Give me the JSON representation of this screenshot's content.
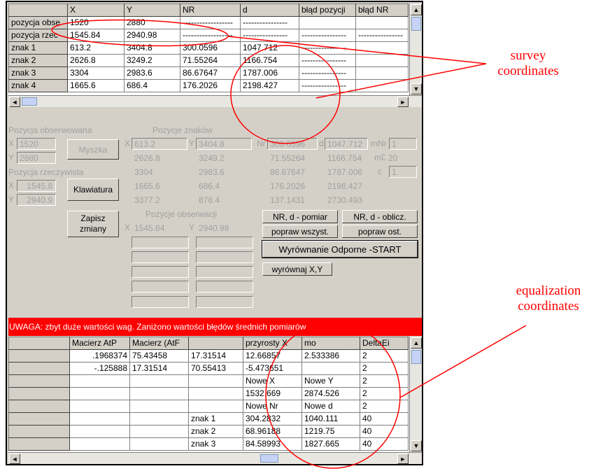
{
  "top_grid": {
    "headers": [
      "",
      "X",
      "Y",
      "NR",
      "d",
      "błąd pozycji",
      "błąd NR"
    ],
    "rows": [
      [
        "pozycja obse",
        "1520",
        "2880",
        "------------------",
        "----------------",
        "",
        ""
      ],
      [
        "pozycja rzec",
        "1545.84",
        "2940.98",
        "------------------",
        "----------------",
        "----------------",
        "----------------"
      ],
      [
        "znak 1",
        "613.2",
        "3404.8",
        "300.0596",
        "1047.712",
        "----------------",
        ""
      ],
      [
        "znak 2",
        "2626.8",
        "3249.2",
        "71.55264",
        "1166.754",
        "----------------",
        ""
      ],
      [
        "znak 3",
        "3304",
        "2983.6",
        "86.67647",
        "1787.006",
        "----------------",
        ""
      ],
      [
        "znak 4",
        "1665.6",
        "686.4",
        "176.2026",
        "2198.427",
        "----------------",
        ""
      ]
    ]
  },
  "panel": {
    "observed_label": "Pozycja obserwowana",
    "observed_x_prefix": "X",
    "observed_x": "1520",
    "observed_y_prefix": "Y",
    "observed_y": "2880",
    "real_label": "Pozycja rzeczywista",
    "real_x_prefix": "X",
    "real_x": "1545.8",
    "real_y_prefix": "Y",
    "real_y": "2940.9",
    "mouse_button": "Myszka",
    "keyboard_button": "Klawiatura",
    "save_button_line1": "Zapisz",
    "save_button_line2": "zmiany",
    "signs_label": "Pozycje znaków",
    "signs_x_prefix": "X",
    "signs_y_prefix": "Y",
    "signs": [
      {
        "x": "613.2",
        "y": "3404.8"
      },
      {
        "x": "2626.8",
        "y": "3249.2"
      },
      {
        "x": "3304",
        "y": "2983.6"
      },
      {
        "x": "1665.6",
        "y": "686.4"
      },
      {
        "x": "3377.2",
        "y": "878.4"
      }
    ],
    "obs_label": "Pozycje obserwacji",
    "obs_x_prefix": "X",
    "obs_x": "1545.84",
    "obs_y_prefix": "Y",
    "obs_y": "2940.98",
    "nr_prefix": "Nr",
    "d_prefix": "d",
    "nr_d": [
      {
        "nr": "300.0596",
        "d": "1047.712"
      },
      {
        "nr": "71.55264",
        "d": "1166.754"
      },
      {
        "nr": "86.67647",
        "d": "1787.006"
      },
      {
        "nr": "176.2026",
        "d": "2198.427"
      },
      {
        "nr": "137.1431",
        "d": "2730.493"
      }
    ],
    "mnr_label": "mNr",
    "mnr_value": "1",
    "md_label": "mD",
    "md_value": "20",
    "c_label": "c",
    "c_value": "1",
    "btn_nr_d_measure": "NR, d - pomiar",
    "btn_nr_d_calc": "NR, d - oblicz.",
    "btn_fix_all": "popraw wszyst.",
    "btn_fix_last": "popraw ost.",
    "btn_robust_start": "Wyrównanie Odporne -START",
    "btn_adjust_xy": "wyrównaj X,Y"
  },
  "warning": "UWAGA: zbyt duże wartości wag. Zaniżono wartości błędów średnich pomiarów",
  "bottom_grid": {
    "headers": [
      "",
      "Macierz AtP",
      "Macierz (AtF",
      "",
      "przyrosty X",
      "mo",
      "DeltaEi"
    ],
    "rows": [
      [
        "",
        ".1968374",
        "75.43458",
        "17.31514",
        "12.66857",
        "2.533386",
        "2"
      ],
      [
        "",
        "-.125888",
        "17.31514",
        "70.55413",
        "-5.473651",
        "",
        "2"
      ],
      [
        "",
        "",
        "",
        "",
        "Nowe X",
        "Nowe Y",
        "2"
      ],
      [
        "",
        "",
        "",
        "",
        "1532.669",
        "2874.526",
        "2"
      ],
      [
        "",
        "",
        "",
        "",
        "Nowe Nr",
        "Nowe d",
        "2"
      ],
      [
        "",
        "",
        "",
        "znak 1",
        "304.2832",
        "1040.111",
        "40"
      ],
      [
        "",
        "",
        "",
        "znak 2",
        "68.96188",
        "1219.75",
        "40"
      ],
      [
        "",
        "",
        "",
        "znak 3",
        "84.58993",
        "1827.665",
        "40"
      ]
    ]
  },
  "annotations": {
    "survey": [
      "survey",
      "coordinates"
    ],
    "equalization": [
      "equalization",
      "coordinates"
    ]
  },
  "colors": {
    "annotation": "#ff0000",
    "warning_bg": "#ff0000",
    "face": "#d4d0c8",
    "selection": "#3a6ea5"
  },
  "icons": [
    "scroll-up-icon",
    "scroll-down-icon",
    "scroll-left-icon",
    "scroll-right-icon"
  ]
}
